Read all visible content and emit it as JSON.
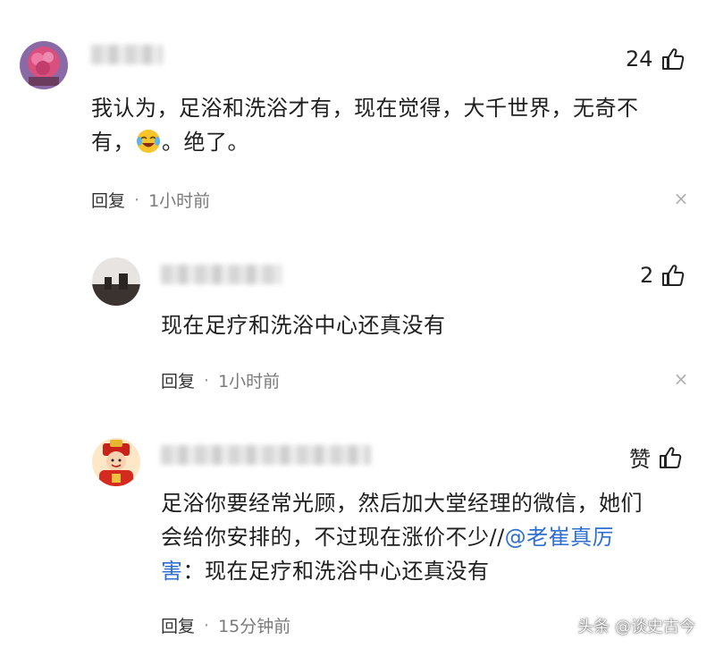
{
  "comments": [
    {
      "like_count": "24",
      "text_line1": "我认为，足浴和洗浴才有，现在觉得，大千世界，无奇不",
      "text_line2_a": "有，",
      "text_line2_b": "。绝了。",
      "emoji": "laughing-crying-emoji",
      "reply_label": "回复",
      "dot": "·",
      "time": "1小时前",
      "close": "×"
    },
    {
      "like_count": "2",
      "text_line1": "现在足疗和洗浴中心还真没有",
      "reply_label": "回复",
      "dot": "·",
      "time": "1小时前",
      "close": "×"
    },
    {
      "like_label": "赞",
      "text_line1": "足浴你要经常光顾，然后加大堂经理的微信，她们",
      "text_line2_a": "会给你安排的，不过现在涨价不少//",
      "mention": "@老崔真厉",
      "text_line3_a": "害",
      "text_line3_b": "：现在足疗和洗浴中心还真没有",
      "reply_label": "回复",
      "dot": "·",
      "time": "15分钟前"
    }
  ],
  "watermark": "头条 @谈史古今",
  "colors": {
    "mention": "#2d6fd2",
    "meta": "#7a7a7a"
  }
}
